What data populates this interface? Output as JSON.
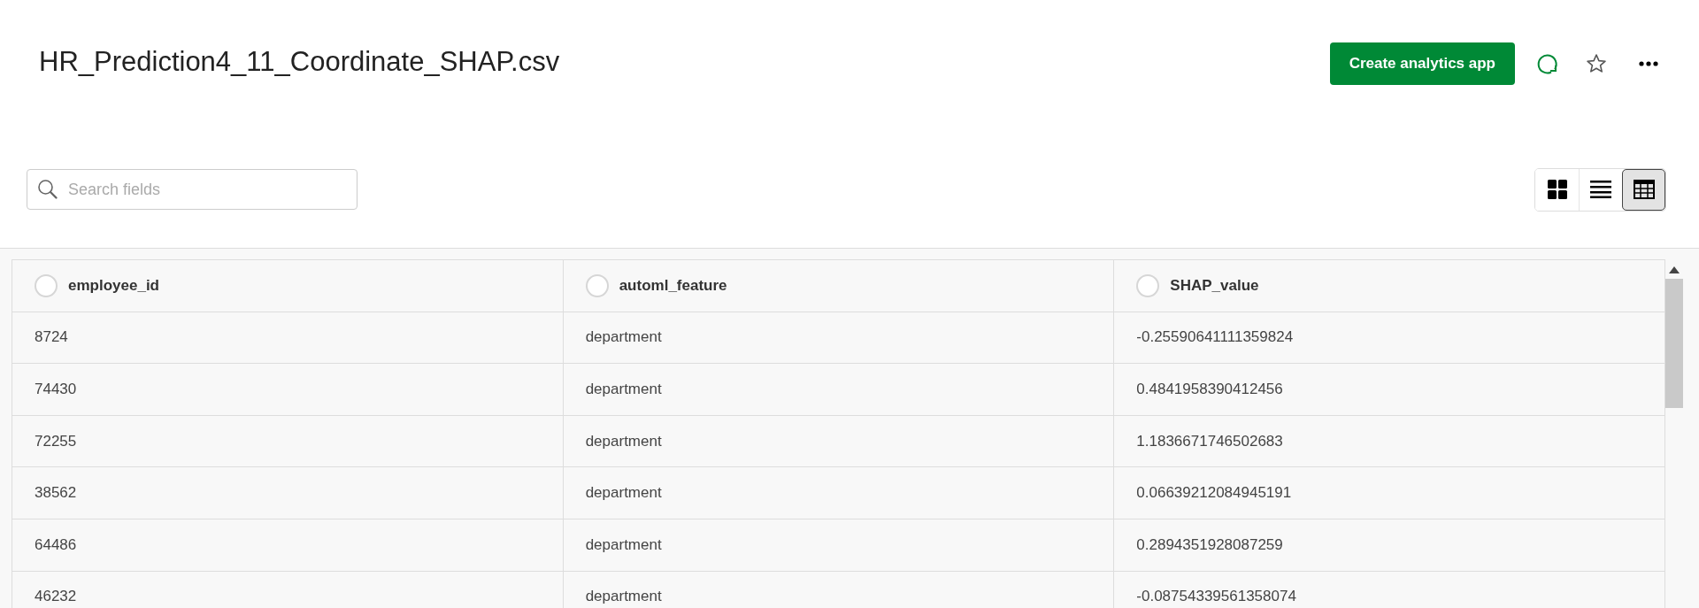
{
  "title": "HR_Prediction4_11_Coordinate_SHAP.csv",
  "create_button": "Create analytics app",
  "search": {
    "placeholder": "Search fields"
  },
  "view_toggles": [
    {
      "kind": "grid",
      "selected": false
    },
    {
      "kind": "list",
      "selected": false
    },
    {
      "kind": "table",
      "selected": true
    }
  ],
  "table": {
    "columns": [
      {
        "label": "employee_id",
        "selected": false
      },
      {
        "label": "automl_feature",
        "selected": false
      },
      {
        "label": "SHAP_value",
        "selected": false
      }
    ],
    "rows": [
      [
        "8724",
        "department",
        "-0.25590641111359824"
      ],
      [
        "74430",
        "department",
        "0.4841958390412456"
      ],
      [
        "72255",
        "department",
        "1.1836671746502683"
      ],
      [
        "38562",
        "department",
        "0.06639212084945191"
      ],
      [
        "64486",
        "department",
        "0.2894351928087259"
      ],
      [
        "46232",
        "department",
        "-0.08754339561358074"
      ]
    ]
  }
}
